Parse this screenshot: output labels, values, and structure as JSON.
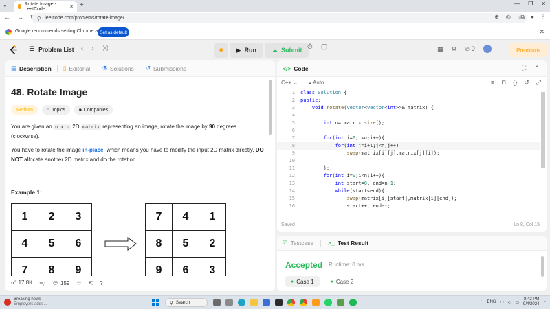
{
  "browser": {
    "tab_title": "Rotate Image - LeetCode",
    "url": "leetcode.com/problems/rotate-image/",
    "infobar_text": "Google recommends setting Chrome as default",
    "set_default_label": "Set as default"
  },
  "header": {
    "problem_list_label": "Problem List",
    "run_label": "Run",
    "submit_label": "Submit",
    "streak_count": "0",
    "premium_label": "Premium"
  },
  "left_tabs": [
    "Description",
    "Editorial",
    "Solutions",
    "Submissions"
  ],
  "problem": {
    "title": "48. Rotate Image",
    "difficulty": "Medium",
    "tags_label": "Topics",
    "companies_label": "Companies",
    "desc1_a": "You are given an ",
    "desc1_code1": "n x n",
    "desc1_b": " 2D ",
    "desc1_code2": "matrix",
    "desc1_c": " representing an image, rotate the image by ",
    "desc1_d": "90",
    "desc1_e": " degrees (clockwise).",
    "desc2_a": "You have to rotate the image ",
    "desc2_b": "in-place",
    "desc2_c": ", which means you have to modify the input 2D matrix directly. ",
    "desc2_d": "DO NOT",
    "desc2_e": " allocate another 2D matrix and do the rotation.",
    "example_label": "Example 1:",
    "input_grid": [
      "1",
      "2",
      "3",
      "4",
      "5",
      "6",
      "7",
      "8",
      "9"
    ],
    "output_grid": [
      "7",
      "4",
      "1",
      "8",
      "5",
      "2",
      "9",
      "6",
      "3"
    ]
  },
  "footer": {
    "likes": "17.8K",
    "comments": "159"
  },
  "code_panel": {
    "title": "Code",
    "language": "C++",
    "auto_label": "Auto",
    "saved_label": "Saved",
    "cursor_pos": "Ln 8, Col 15",
    "lines": [
      {
        "n": "1",
        "t": "class Solution {"
      },
      {
        "n": "2",
        "t": "public:"
      },
      {
        "n": "3",
        "t": "    void rotate(vector<vector<int>>& matrix) {"
      },
      {
        "n": "4",
        "t": ""
      },
      {
        "n": "5",
        "t": "        int n= matrix.size();"
      },
      {
        "n": "6",
        "t": ""
      },
      {
        "n": "7",
        "t": "        for(int i=0;i<n;i++){"
      },
      {
        "n": "8",
        "t": "            for(int j=i+1;j<n;j++)"
      },
      {
        "n": "9",
        "t": "                swap(matrix[i][j],matrix[j][i]);"
      },
      {
        "n": "10",
        "t": ""
      },
      {
        "n": "11",
        "t": "        };"
      },
      {
        "n": "12",
        "t": "        for(int i=0;i<n;i++){"
      },
      {
        "n": "13",
        "t": "            int start=0, end=n-1;"
      },
      {
        "n": "14",
        "t": "            while(start<end){"
      },
      {
        "n": "15",
        "t": "                swap(matrix[i][start],matrix[i][end]);"
      },
      {
        "n": "16",
        "t": "                start++, end--;"
      }
    ]
  },
  "test_panel": {
    "testcase_label": "Testcase",
    "result_label": "Test Result",
    "status": "Accepted",
    "runtime": "Runtime: 0 ms",
    "cases": [
      "Case 1",
      "Case 2"
    ]
  },
  "taskbar": {
    "news_title": "Breaking news",
    "news_sub": "Employers adde...",
    "search_label": "Search",
    "lang": "ENG",
    "time": "8:42 PM",
    "date": "9/4/2024"
  }
}
